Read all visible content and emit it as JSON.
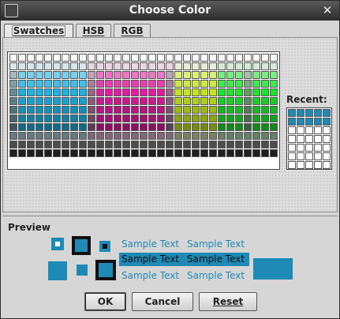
{
  "window": {
    "title": "Choose Color"
  },
  "tabs": [
    {
      "label": "Swatches",
      "active": true
    },
    {
      "label": "HSB",
      "active": false
    },
    {
      "label": "RGB",
      "active": false
    }
  ],
  "swatches": {
    "recent_label": "Recent:"
  },
  "preview": {
    "label": "Preview",
    "color": "#1f8ab5",
    "samples": [
      "Sample Text",
      "Sample Text",
      "Sample Text",
      "Sample Text",
      "Sample Text",
      "Sample Text"
    ]
  },
  "buttons": {
    "ok": "OK",
    "cancel": "Cancel",
    "reset": "Reset"
  }
}
